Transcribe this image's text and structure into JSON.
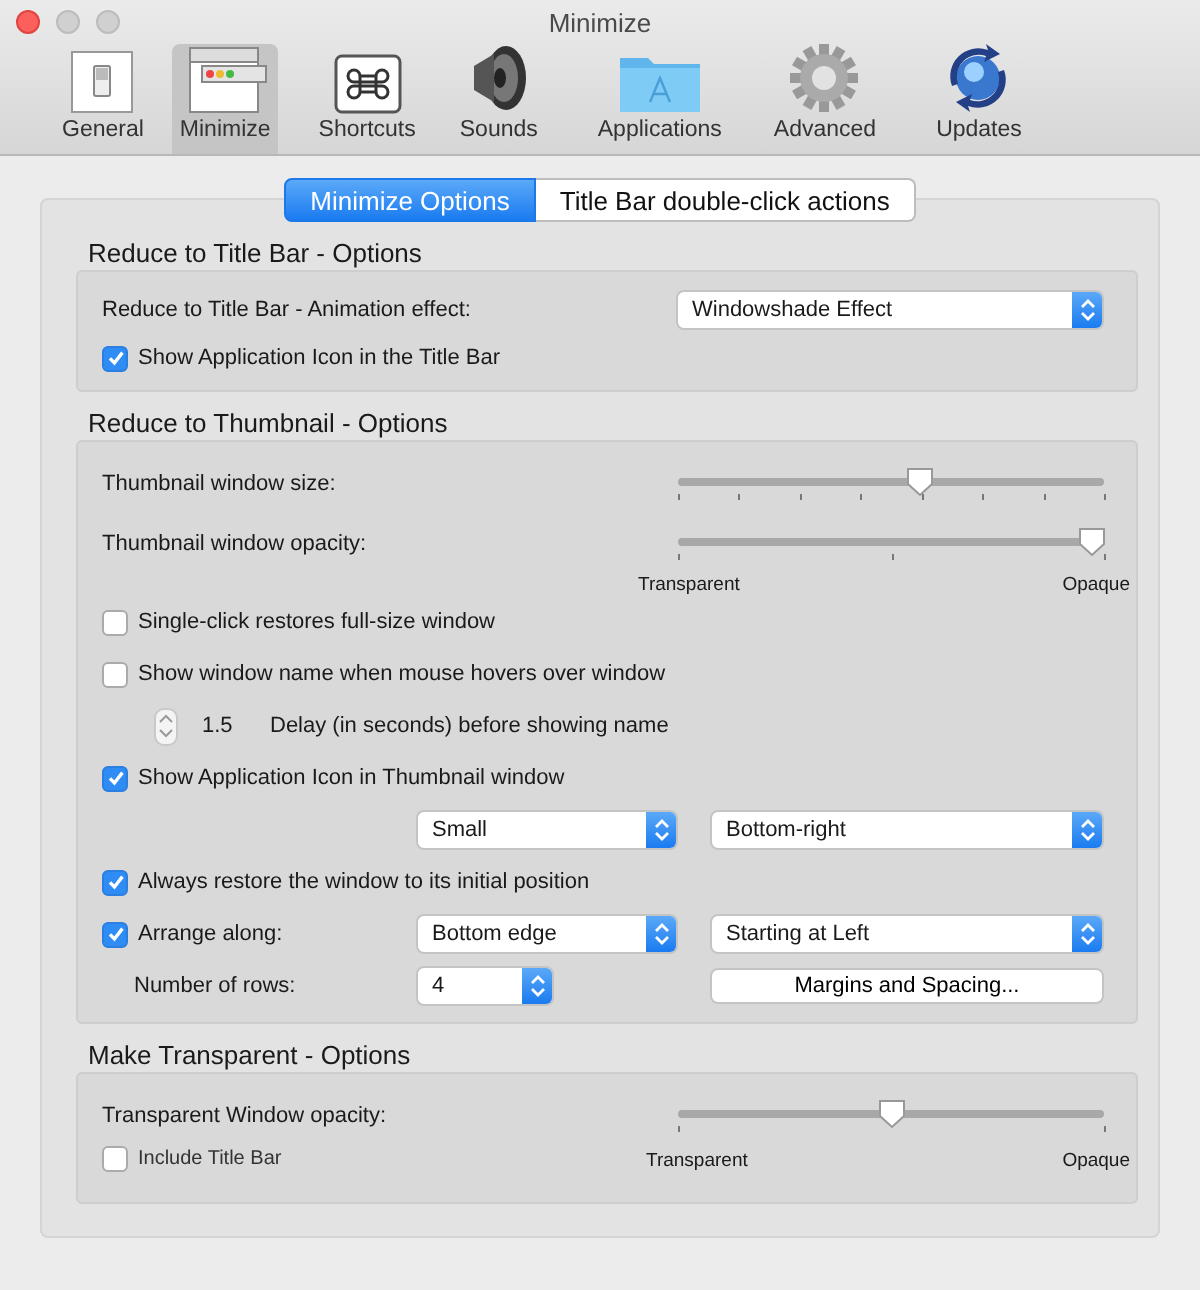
{
  "window": {
    "title": "Minimize"
  },
  "toolbar": [
    {
      "label": "General",
      "selected": false
    },
    {
      "label": "Minimize",
      "selected": true
    },
    {
      "label": "Shortcuts",
      "selected": false
    },
    {
      "label": "Sounds",
      "selected": false
    },
    {
      "label": "Applications",
      "selected": false
    },
    {
      "label": "Advanced",
      "selected": false
    },
    {
      "label": "Updates",
      "selected": false
    }
  ],
  "tabs": [
    {
      "label": "Minimize Options",
      "selected": true
    },
    {
      "label": "Title Bar double-click actions",
      "selected": false
    }
  ],
  "title_bar_section": {
    "title": "Reduce to Title Bar - Options",
    "animation_label": "Reduce to Title Bar - Animation effect:",
    "animation_value": "Windowshade Effect",
    "show_icon": {
      "label": "Show Application Icon in the Title Bar",
      "checked": true
    }
  },
  "thumbnail_section": {
    "title": "Reduce to Thumbnail - Options",
    "size": {
      "label": "Thumbnail window size:",
      "level": 0.57
    },
    "opacity": {
      "label": "Thumbnail window opacity:",
      "level": 0.97,
      "min_label": "Transparent",
      "max_label": "Opaque"
    },
    "single_click": {
      "label": "Single-click restores full-size window",
      "checked": false
    },
    "show_name": {
      "label": "Show window name when mouse hovers over window",
      "checked": false
    },
    "delay": {
      "value": "1.5",
      "label": "Delay (in seconds) before showing name"
    },
    "show_icon": {
      "label": "Show Application Icon in Thumbnail window",
      "checked": true
    },
    "icon_size": "Small",
    "icon_position": "Bottom-right",
    "always_restore": {
      "label": "Always restore the window to its initial position",
      "checked": true
    },
    "arrange": {
      "label": "Arrange along:",
      "checked": true,
      "edge": "Bottom edge",
      "start": "Starting at Left"
    },
    "rows": {
      "label": "Number of rows:",
      "value": "4"
    },
    "margins_button": "Margins and Spacing..."
  },
  "transparent_section": {
    "title": "Make Transparent - Options",
    "opacity": {
      "label": "Transparent Window opacity:",
      "level": 0.5,
      "min_label": "Transparent",
      "max_label": "Opaque"
    },
    "include_title_bar": {
      "label": "Include Title Bar",
      "checked": false
    }
  }
}
